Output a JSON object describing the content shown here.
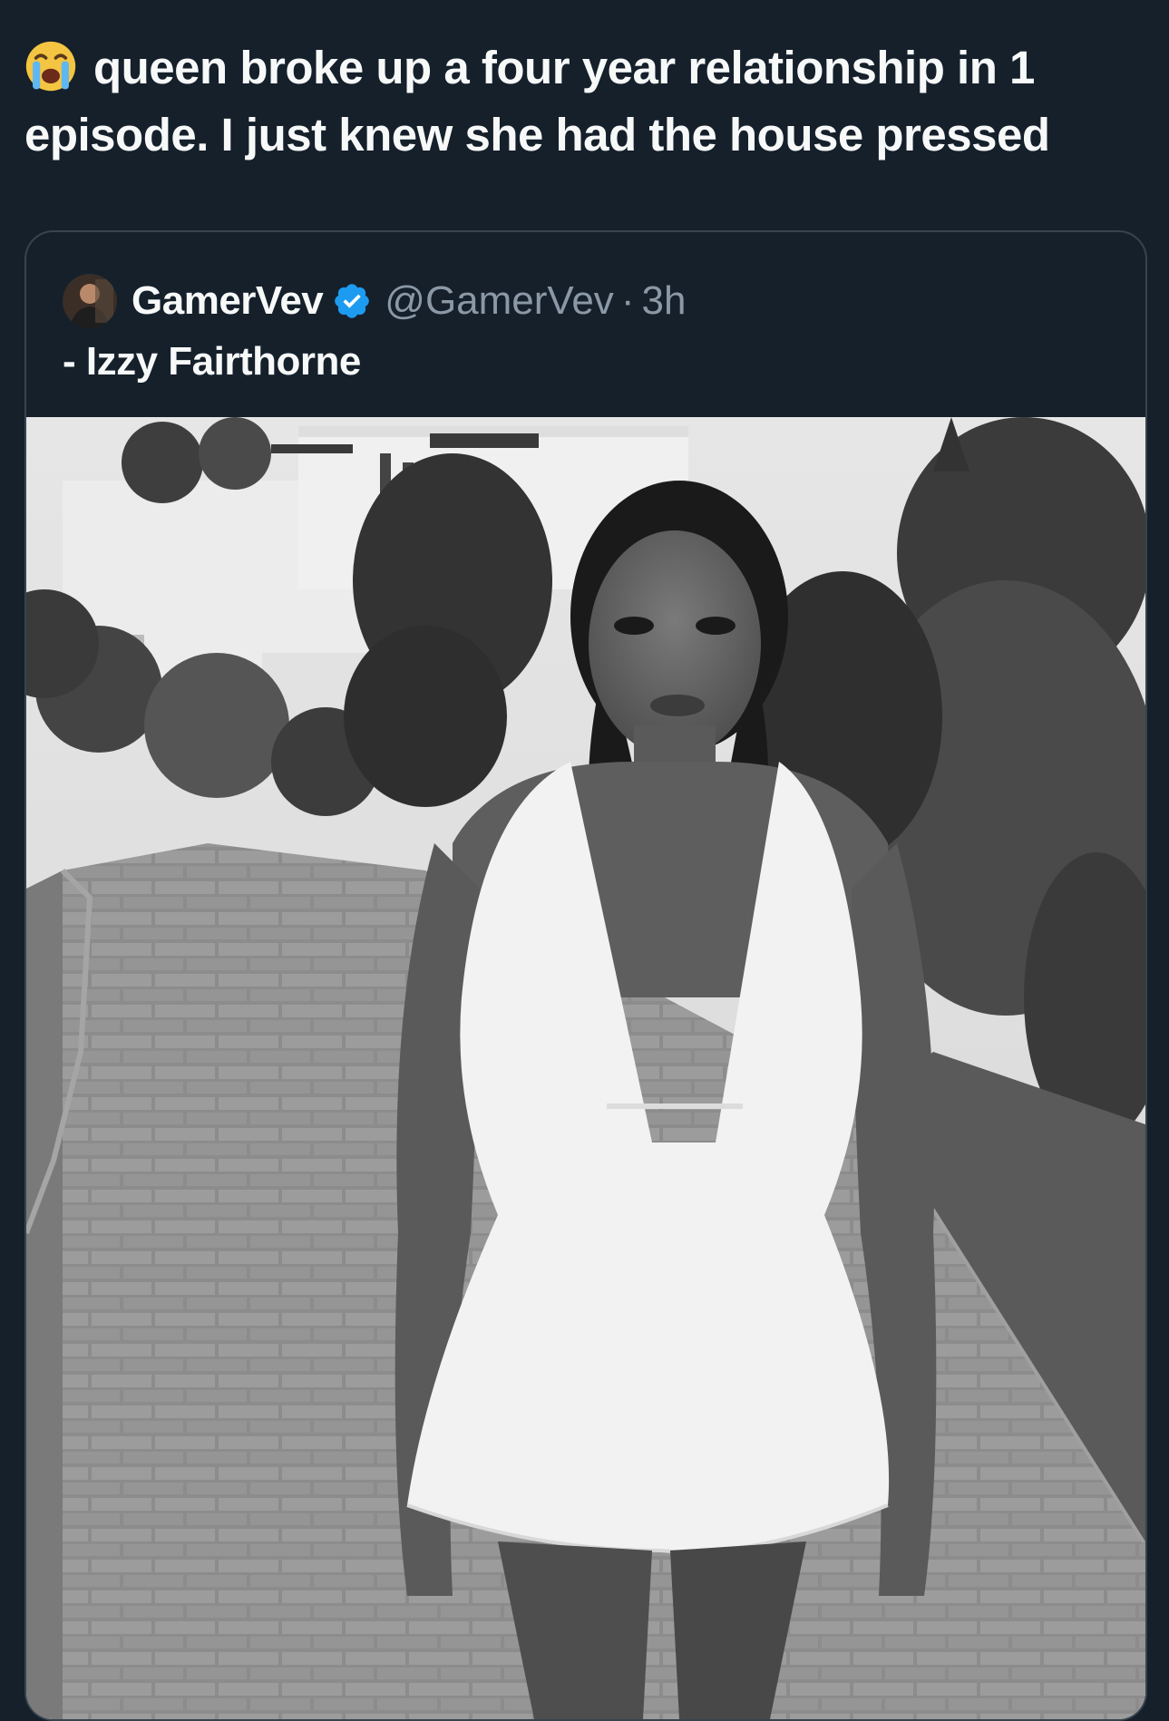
{
  "post": {
    "emoji": "loudly-crying-face-icon",
    "text": "queen broke up a four year relationship in 1 episode. I just knew she had the house pressed"
  },
  "quote": {
    "display_name": "GamerVev",
    "verified": "verified-badge-icon",
    "handle": "@GamerVev",
    "separator": "·",
    "time": "3h",
    "text": "- Izzy Fairthorne"
  },
  "colors": {
    "background": "#15202b",
    "border": "#38444d",
    "text_primary": "#f7f9f9",
    "text_secondary": "#8b98a5",
    "verified_blue": "#1d9bf0"
  }
}
